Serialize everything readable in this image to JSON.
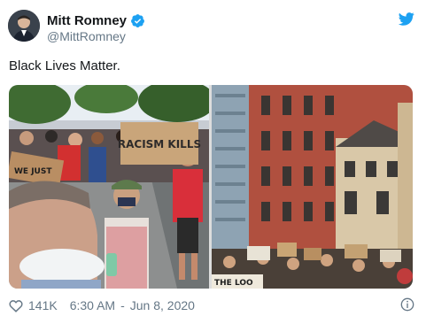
{
  "tweet": {
    "author_name": "Mitt Romney",
    "author_handle": "@MittRomney",
    "text": "Black Lives Matter.",
    "like_count": "141K",
    "time": "6:30 AM",
    "date_separator": "-",
    "date": "Jun 8, 2020"
  },
  "media": {
    "left_photo_signs": [
      "RACISM KILLS"
    ],
    "left_photo_partial_sign": "WE JUST",
    "right_photo_partial_sign": "THE LOO"
  },
  "icons": {
    "verified": "verified-badge-icon",
    "brand": "twitter-bird-icon",
    "like": "heart-icon",
    "info": "info-icon"
  },
  "colors": {
    "brand_blue": "#1da1f2",
    "name_text": "#14171a",
    "secondary_text": "#657786"
  }
}
